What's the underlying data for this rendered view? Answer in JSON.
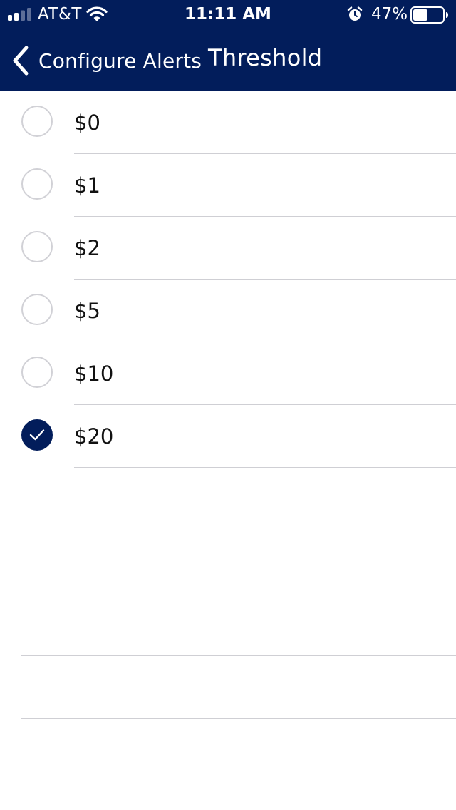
{
  "status_bar": {
    "carrier": "AT&T",
    "time": "11:11 AM",
    "battery_percent": "47%",
    "signal_bars_filled": 2,
    "signal_bars_total": 4,
    "battery_level": 0.47,
    "icons": [
      "signal-icon",
      "wifi-icon",
      "alarm-icon",
      "battery-icon"
    ]
  },
  "nav": {
    "back_label": "Configure Alerts",
    "title": "Threshold",
    "back_icon": "chevron-left-icon"
  },
  "options": [
    {
      "label": "$0",
      "checked": false
    },
    {
      "label": "$1",
      "checked": false
    },
    {
      "label": "$2",
      "checked": false
    },
    {
      "label": "$5",
      "checked": false
    },
    {
      "label": "$10",
      "checked": false
    },
    {
      "label": "$20",
      "checked": true
    }
  ],
  "colors": {
    "brand": "#021d5b",
    "separator": "#cfcfd4",
    "radio_border": "#d1d1d6"
  }
}
